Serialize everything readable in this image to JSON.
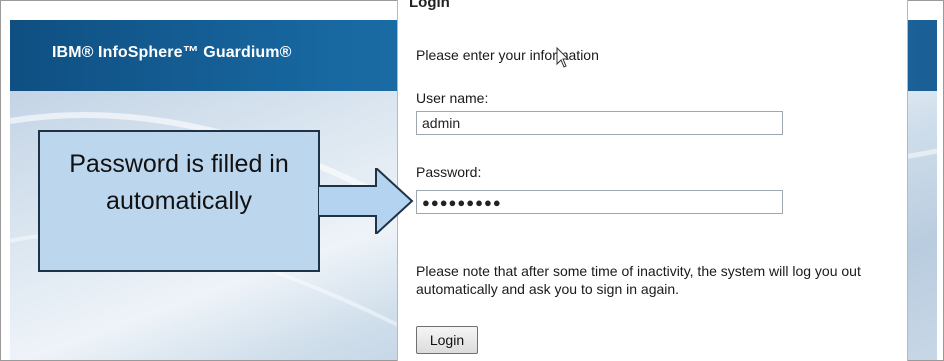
{
  "header": {
    "brand": "IBM® InfoSphere™ Guardium®"
  },
  "login": {
    "heading": "Login",
    "instruction": "Please enter your information",
    "username_label": "User name:",
    "username_value": "admin",
    "password_label": "Password:",
    "password_value": "●●●●●●●●●",
    "note": "Please note that after some time of inactivity, the system will log you out automatically and ask you to sign in again.",
    "button_label": "Login"
  },
  "callout": {
    "text": "Password is filled in automatically"
  },
  "colors": {
    "header_blue": "#1868a1",
    "callout_fill": "#bcd6ee",
    "arrow_fill": "#b3d3f0"
  },
  "icons": {
    "cursor": "arrow-cursor-icon"
  }
}
